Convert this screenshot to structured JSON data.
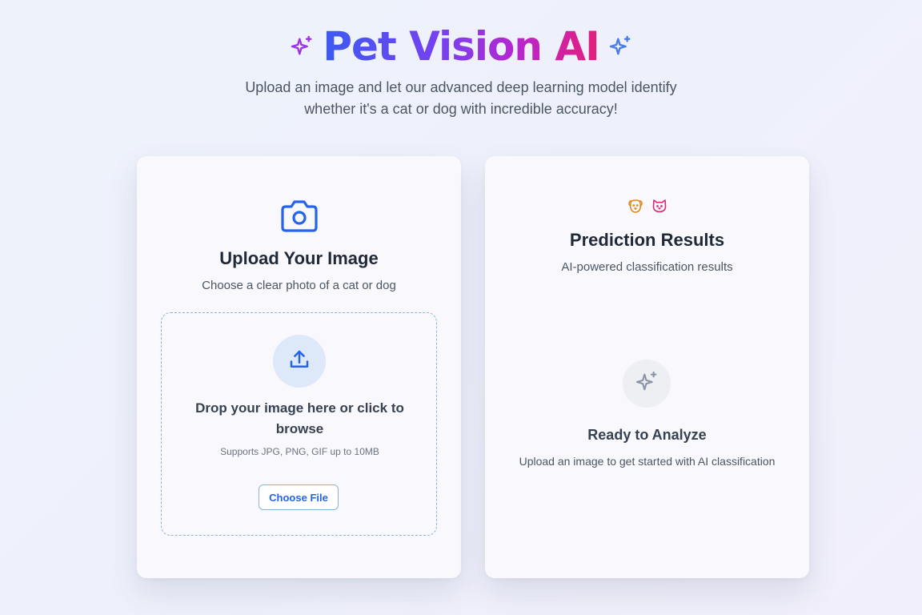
{
  "header": {
    "title": "Pet Vision AI",
    "subtitle": "Upload an image and let our advanced deep learning model identify whether it's a cat or dog with incredible accuracy!",
    "left_icon": "sparkles-icon",
    "right_icon": "sparkles-icon"
  },
  "upload_card": {
    "icon": "camera-icon",
    "title": "Upload Your Image",
    "subtitle": "Choose a clear photo of a cat or dog",
    "dropzone": {
      "icon": "upload-icon",
      "text": "Drop your image here or click to browse",
      "hint": "Supports JPG, PNG, GIF up to 10MB",
      "button_label": "Choose File"
    }
  },
  "results_card": {
    "icons": [
      "dog-icon",
      "cat-icon"
    ],
    "title": "Prediction Results",
    "subtitle": "AI-powered classification results",
    "empty_state": {
      "icon": "sparkles-icon",
      "title": "Ready to Analyze",
      "subtitle": "Upload an image to get started with AI classification"
    }
  },
  "colors": {
    "brand_blue": "#3b5bf0",
    "brand_purple": "#7b3ff0",
    "brand_pink": "#e5207a",
    "primary": "#2563eb",
    "dog_icon": "#e08a1e",
    "cat_icon": "#db2777"
  }
}
